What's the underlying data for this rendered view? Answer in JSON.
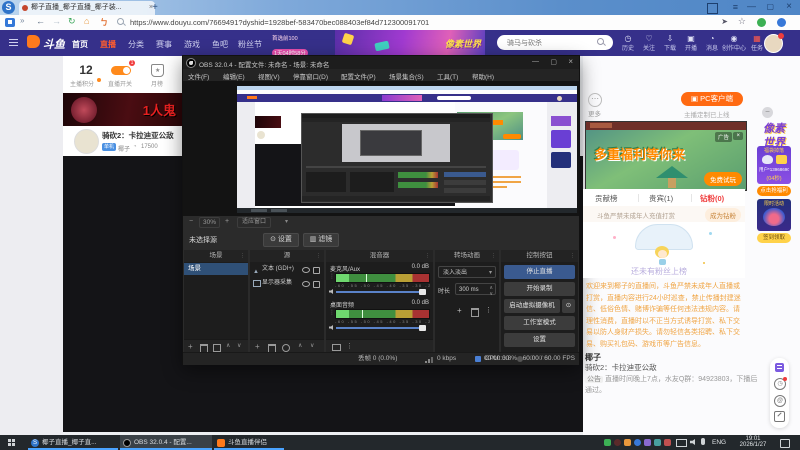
{
  "browser": {
    "tab": {
      "title": "椰子直播_椰子直播_椰子装...",
      "close": "×",
      "new_tab": "+"
    },
    "url": "https://www.douyu.com/7669491?dyshid=1928bef-583470bec088403ef84d712300091701",
    "controls": {
      "min": "—",
      "max": "▢",
      "close": "×"
    }
  },
  "site_header": {
    "logo_text": "斗鱼",
    "nav": [
      "首页",
      "直播",
      "分类",
      "赛事",
      "游戏",
      "鱼吧",
      "粉丝节"
    ],
    "event_badge_top": "首选前100",
    "event_badge_bottom": "1天04时58分",
    "banner_text": "像素世界",
    "search_placeholder": "骑马与砍杀",
    "actions": [
      "历史",
      "关注",
      "下载",
      "开播",
      "消息",
      "创作中心",
      "任务"
    ]
  },
  "anchor_panel": {
    "score": "12",
    "score_label": "主播积分",
    "live_toggle_label": "直播开关",
    "live_toggle_badge": "1",
    "rank_label": "月榜",
    "promo_text": "1人鬼",
    "room": {
      "title": "骑砍2：卡拉迪亚公敌",
      "tag": "单机",
      "name": "椰子",
      "viewers": "17500"
    }
  },
  "obs": {
    "title": "OBS 32.0.4 - 配置文件: 未命名 - 场景: 未命名",
    "menu": [
      "文件(F)",
      "编辑(E)",
      "视图(V)",
      "停靠窗口(D)",
      "配置文件(P)",
      "场景集合(S)",
      "工具(T)",
      "帮助(H)"
    ],
    "zoom": {
      "minus": "−",
      "level": "30%",
      "plus": "+",
      "fit": "适应窗口"
    },
    "no_source_hint": "未选择源",
    "buttons": {
      "settings": "设置",
      "filters": "滤镜"
    },
    "docks": {
      "scenes": {
        "title": "场景",
        "item": "场景"
      },
      "sources": {
        "title": "源",
        "item1": "文本 (GDI+)",
        "item2": "显示器采集"
      },
      "mixer": {
        "title": "混音器",
        "ch1_name": "麦克风/Aux",
        "ch1_db": "0.0 dB",
        "ch2_name": "桌面音频",
        "ch2_db": "0.0 dB",
        "scale": "-60 -55 -50 -45 -40 -35 -30 -25 -20 -15 -10 -5 0"
      },
      "transitions": {
        "title": "转场动画",
        "selected": "淡入淡出",
        "duration_label": "时长",
        "duration": "300 ms"
      },
      "controls": {
        "title": "控制按钮",
        "stop_stream": "停止直播",
        "start_record": "开始录制",
        "virtual_cam": "启动虚拟摄像机",
        "studio_mode": "工作室模式",
        "settings": "设置"
      }
    },
    "status": {
      "dropped": "丢帧 0 (0.0%)",
      "bitrate": "0 kbps",
      "stream_time": "00:00:00",
      "rec_time": "00:00:00",
      "cpu": "CPU: 3.8%",
      "fps": "60.00 / 60.00 FPS"
    }
  },
  "room_panel": {
    "more": "更多",
    "pc_client": "PC客户端",
    "pc_client_sub": "主播定制已上线",
    "ad": {
      "label": "广告",
      "close": "×",
      "slogan": "多重福利等你来",
      "cta": "免费试玩"
    },
    "tabs": [
      "贡献榜",
      "贵宾(1)",
      "钻粉(0)"
    ],
    "notice": "斗鱼严禁未成年人充值打赏",
    "become_fan": "成为钻粉",
    "empty_hint": "还未有粉丝上榜",
    "rules": "欢迎来到椰子的直播间，斗鱼严禁未成年人直播或打赏，直播内容进行24小时巡查，禁止传播封建迷信、低俗色情、赌博诈骗等任何违法违规内容。请理性消费，直播时以不正当方式诱导打赏、私下交易以防人身财产损失。请勿轻信各类招聘、私下交易、购买礼包码、游戏币等广告信息。",
    "streamer_name": "椰子",
    "room_title": "骑砍2：卡拉迪亚公敌",
    "announcement_label": "公告",
    "announcement": "直播时间晚上7点，水友Q群：94923803，下播后通过。"
  },
  "right_rail": {
    "pixel_world_1": "像素",
    "pixel_world_2": "世界",
    "drop_title": "福袋掉落",
    "drop_user": "用户*13968690...",
    "drop_countdown": "(04秒)",
    "grab_btn": "点击抢福利",
    "event_title": "限时活动",
    "signin_btn": "签到领取"
  },
  "taskbar": {
    "app1": "椰子直播_椰子直...",
    "app2": "OBS 32.0.4 - 配置...",
    "app3": "斗鱼直播伴侣",
    "lang": "ENG",
    "time": "19:01",
    "date": "2026/1/27"
  }
}
